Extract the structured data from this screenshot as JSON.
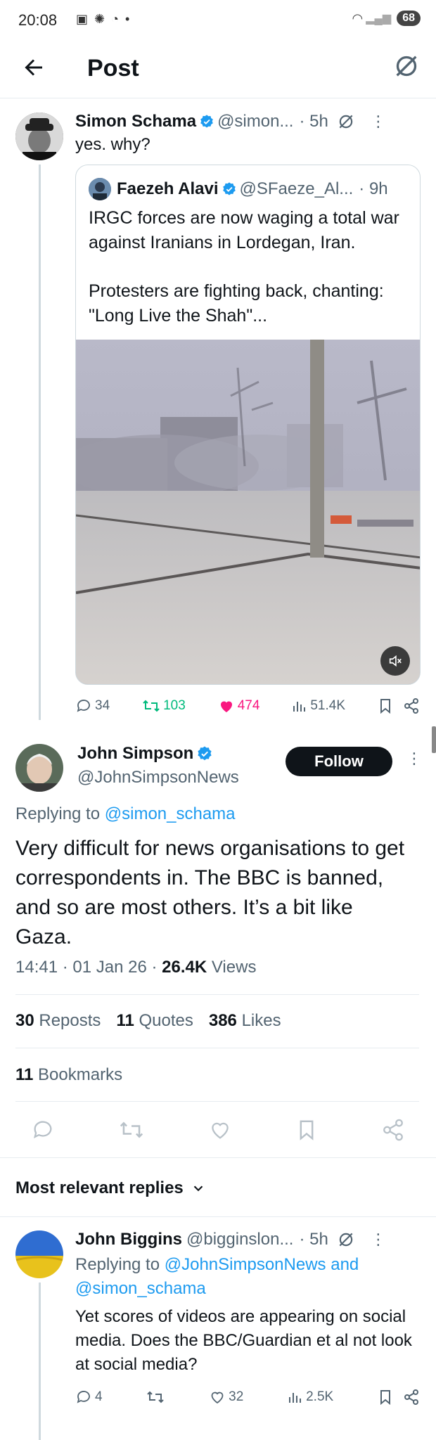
{
  "status_bar": {
    "time": "20:08",
    "battery": "68"
  },
  "header": {
    "title": "Post"
  },
  "parent_post": {
    "name": "Simon Schama",
    "handle": "@simon...",
    "time": "· 5h",
    "text": "yes. why?",
    "quote": {
      "name": "Faezeh Alavi",
      "handle": "@SFaeze_Al...",
      "time": "· 9h",
      "text_line1": "IRGC forces are now waging a total war against Iranians in Lordegan, Iran.",
      "text_line2": "Protesters are fighting back, chanting: \"Long Live the Shah\"..."
    },
    "stats": {
      "replies": "34",
      "reposts": "103",
      "likes": "474",
      "views": "51.4K"
    }
  },
  "main_post": {
    "name": "John Simpson",
    "handle": "@JohnSimpsonNews",
    "follow_label": "Follow",
    "replying_prefix": "Replying to",
    "replying_to": "@simon_schama",
    "text": "Very difficult for news organisations to get correspondents in.  The BBC is banned, and so are most others.  It’s a bit like Gaza.",
    "timestamp": "14:41 · 01 Jan 26 · ",
    "views_count": "26.4K",
    "views_label": "Views",
    "reposts_count": "30",
    "reposts_label": "Reposts",
    "quotes_count": "11",
    "quotes_label": "Quotes",
    "likes_count": "386",
    "likes_label": "Likes",
    "bookmarks_count": "11",
    "bookmarks_label": "Bookmarks"
  },
  "replies_section": {
    "sort_label": "Most relevant replies"
  },
  "reply": {
    "name": "John Biggins",
    "handle": "@bigginslon...",
    "time": "· 5h",
    "replying_prefix": "Replying to",
    "replying_to_1": "@JohnSimpsonNews",
    "and": "and",
    "replying_to_2": "@simon_schama",
    "text": "Yet scores of videos are appearing on social media. Does the BBC/Guardian et al not look at social media?",
    "stats": {
      "replies": "4",
      "likes": "32",
      "views": "2.5K"
    }
  },
  "colors": {
    "accent": "#1d9bf0",
    "like": "#f91880",
    "repost": "#00ba7c"
  }
}
